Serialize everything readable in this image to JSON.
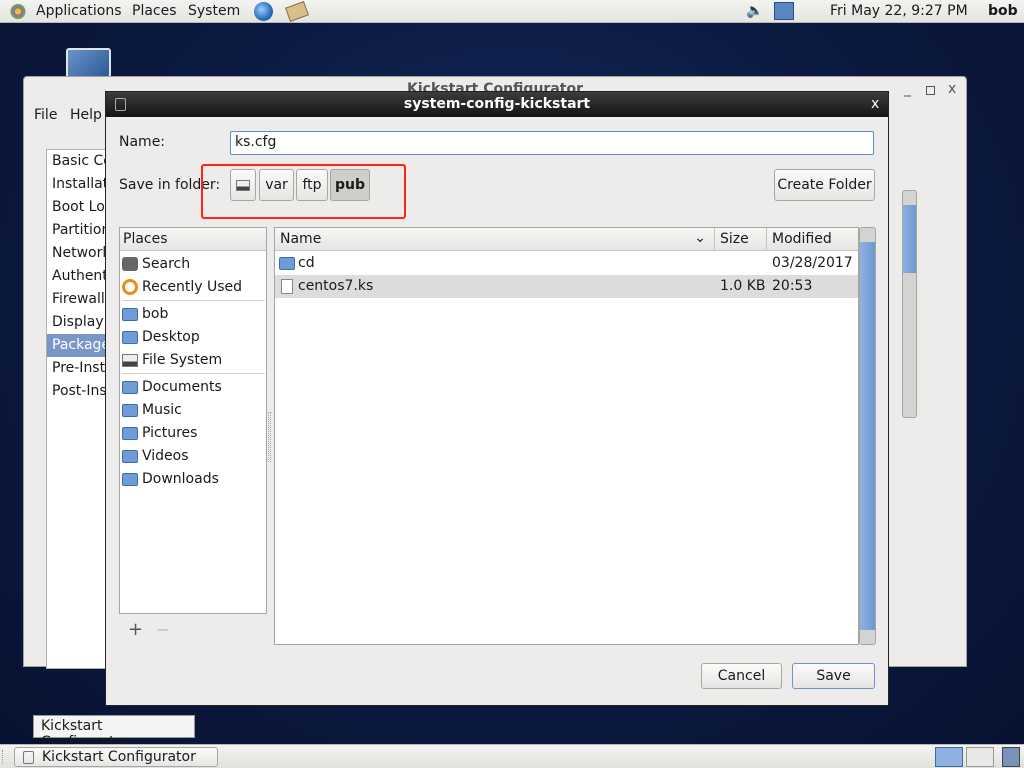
{
  "top_panel": {
    "menus": [
      "Applications",
      "Places",
      "System"
    ],
    "clock": "Fri May 22,  9:27 PM",
    "user": "bob"
  },
  "back_window": {
    "title": "Kickstart Configurator",
    "menu": [
      "File",
      "Help"
    ],
    "sections": [
      "Basic Co",
      "Installati",
      "Boot Loa",
      "Partition",
      "Network",
      "Authenti",
      "Firewall",
      "Display",
      "Package",
      "Pre-Insta",
      "Post-Inst"
    ],
    "selected": "Package"
  },
  "dialog": {
    "title": "system-config-kickstart",
    "close": "x",
    "name_label": "Name:",
    "name_value": "ks.cfg",
    "folder_label": "Save in folder:",
    "path": [
      "var",
      "ftp",
      "pub"
    ],
    "create_folder": "Create Folder",
    "places_header": "Places",
    "places": [
      "Search",
      "Recently Used",
      "bob",
      "Desktop",
      "File System",
      "Documents",
      "Music",
      "Pictures",
      "Videos",
      "Downloads"
    ],
    "add": "+",
    "remove": "−",
    "columns": {
      "name": "Name",
      "size": "Size",
      "modified": "Modified"
    },
    "files": [
      {
        "name": "cd",
        "size": "",
        "modified": "03/28/2017",
        "type": "folder"
      },
      {
        "name": "centos7.ks",
        "size": "1.0 KB",
        "modified": "20:53",
        "type": "file"
      }
    ],
    "cancel": "Cancel",
    "save": "Save"
  },
  "tooltip": "Kickstart Configurator",
  "taskbar": {
    "task": "Kickstart Configurator"
  },
  "colors": {
    "highlight": "#7896c8",
    "annotation": "#ff2020"
  }
}
